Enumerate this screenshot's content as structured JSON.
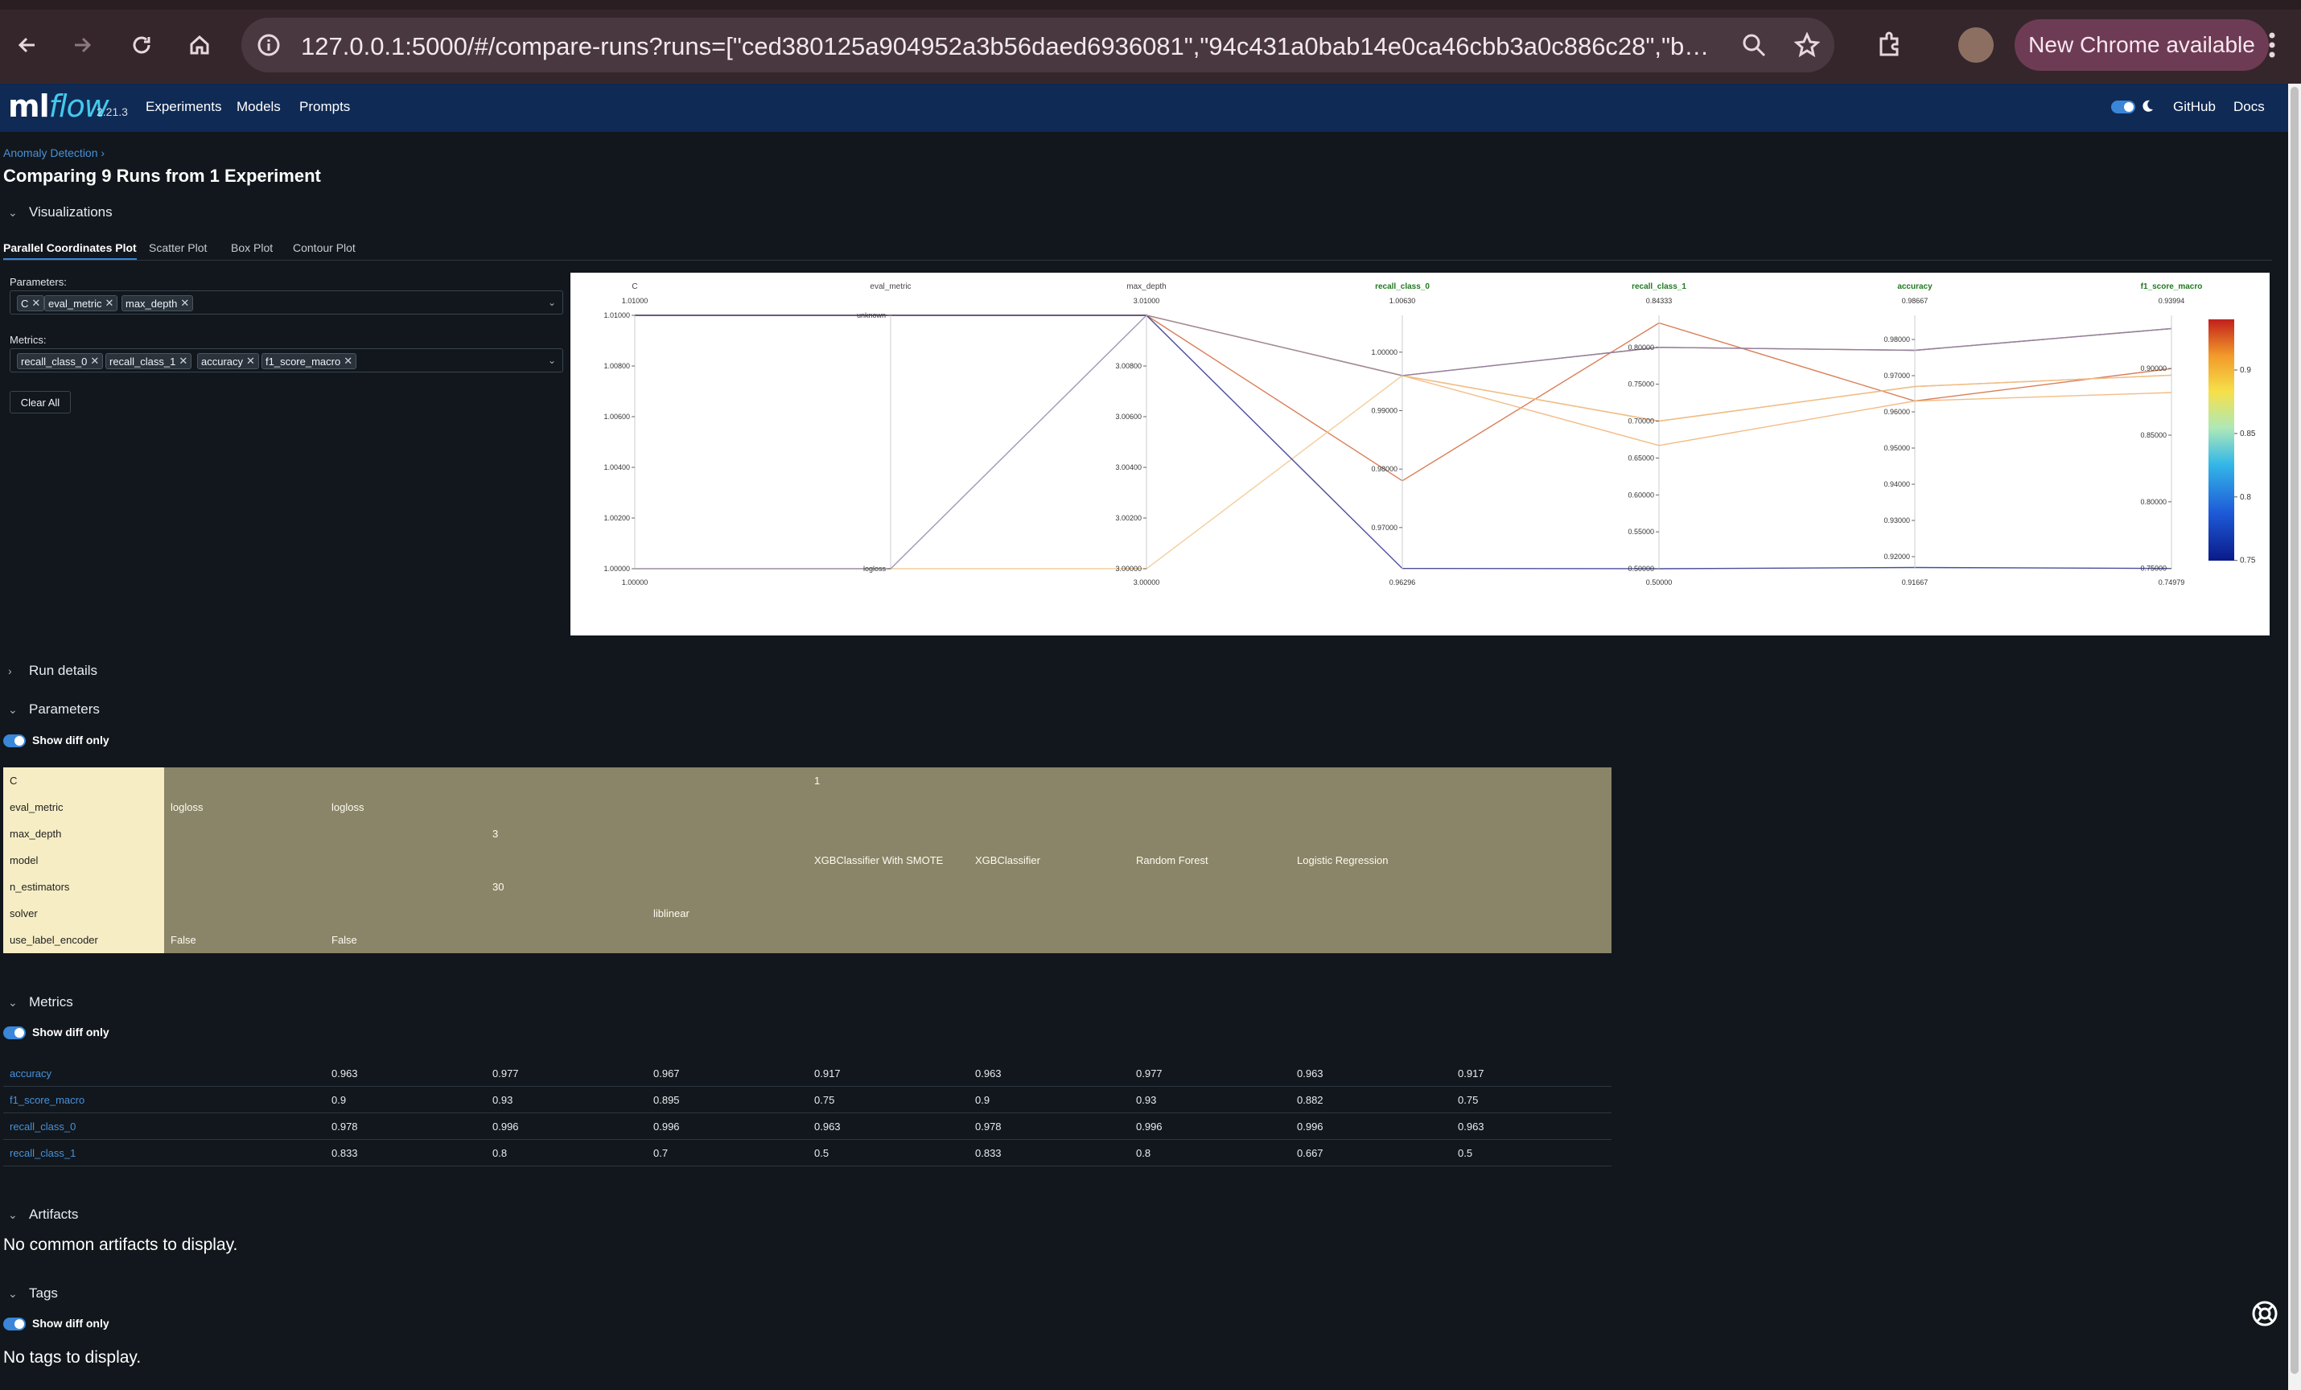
{
  "browser": {
    "url": "127.0.0.1:5000/#/compare-runs?runs=[\"ced380125a904952a3b56daed6936081\",\"94c431a0bab14e0ca46cbb3a0c886c28\",\"bc4f1...",
    "update_label": "New Chrome available"
  },
  "header": {
    "logo_ml": "ml",
    "logo_flow": "flow",
    "version": "2.21.3",
    "nav": [
      "Experiments",
      "Models",
      "Prompts"
    ],
    "github": "GitHub",
    "docs": "Docs"
  },
  "breadcrumb": "Anomaly Detection ›",
  "title": "Comparing 9 Runs from 1 Experiment",
  "sections": {
    "visualizations": "Visualizations",
    "run_details": "Run details",
    "parameters": "Parameters",
    "metrics": "Metrics",
    "artifacts": "Artifacts",
    "tags": "Tags"
  },
  "viz_tabs": [
    "Parallel Coordinates Plot",
    "Scatter Plot",
    "Box Plot",
    "Contour Plot"
  ],
  "controls": {
    "parameters_label": "Parameters:",
    "parameter_chips": [
      "C",
      "eval_metric",
      "max_depth"
    ],
    "metrics_label": "Metrics:",
    "metric_chips": [
      "recall_class_0",
      "recall_class_1",
      "accuracy",
      "f1_score_macro"
    ],
    "clear_all": "Clear All"
  },
  "show_diff_only": "Show diff only",
  "parameters_table": [
    {
      "key": "C",
      "values": [
        "",
        "",
        "",
        "",
        "1",
        "",
        "",
        "",
        ""
      ]
    },
    {
      "key": "eval_metric",
      "values": [
        "logloss",
        "logloss",
        "",
        "",
        "",
        "",
        "",
        "",
        ""
      ]
    },
    {
      "key": "max_depth",
      "values": [
        "",
        "",
        "3",
        "",
        "",
        "",
        "",
        "",
        ""
      ]
    },
    {
      "key": "model",
      "values": [
        "",
        "",
        "",
        "",
        "XGBClassifier With SMOTE",
        "XGBClassifier",
        "Random Forest",
        "Logistic Regression",
        ""
      ]
    },
    {
      "key": "n_estimators",
      "values": [
        "",
        "",
        "30",
        "",
        "",
        "",
        "",
        "",
        ""
      ]
    },
    {
      "key": "solver",
      "values": [
        "",
        "",
        "",
        "liblinear",
        "",
        "",
        "",
        "",
        ""
      ]
    },
    {
      "key": "use_label_encoder",
      "values": [
        "False",
        "False",
        "",
        "",
        "",
        "",
        "",
        "",
        ""
      ]
    }
  ],
  "metrics_table": [
    {
      "key": "accuracy",
      "values": [
        "0.963",
        "0.977",
        "0.967",
        "0.917",
        "0.963",
        "0.977",
        "0.963",
        "0.917"
      ]
    },
    {
      "key": "f1_score_macro",
      "values": [
        "0.9",
        "0.93",
        "0.895",
        "0.75",
        "0.9",
        "0.93",
        "0.882",
        "0.75"
      ]
    },
    {
      "key": "recall_class_0",
      "values": [
        "0.978",
        "0.996",
        "0.996",
        "0.963",
        "0.978",
        "0.996",
        "0.996",
        "0.963"
      ]
    },
    {
      "key": "recall_class_1",
      "values": [
        "0.833",
        "0.8",
        "0.7",
        "0.5",
        "0.833",
        "0.8",
        "0.667",
        "0.5"
      ]
    }
  ],
  "artifacts_msg": "No common artifacts to display.",
  "tags_msg": "No tags to display.",
  "chart_data": {
    "type": "parallel-coordinates",
    "axes": [
      {
        "name": "C",
        "min": 1.0,
        "max": 1.01,
        "top": "1.01000",
        "bottom": "1.00000",
        "ticks": [
          "1.01000",
          "1.00800",
          "1.00600",
          "1.00400",
          "1.00200",
          "1.00000"
        ],
        "categorical": false
      },
      {
        "name": "eval_metric",
        "top": "",
        "bottom": "",
        "ticks": [
          "unknown",
          "logloss"
        ],
        "categorical": true
      },
      {
        "name": "max_depth",
        "min": 3.0,
        "max": 3.01,
        "top": "3.01000",
        "bottom": "3.00000",
        "ticks": [
          "3.00800",
          "3.00600",
          "3.00400",
          "3.00200",
          "3.00000"
        ],
        "categorical": false
      },
      {
        "name": "recall_class_0",
        "min": 0.96296,
        "max": 1.0063,
        "top": "1.00630",
        "bottom": "0.96296",
        "ticks": [
          "1.00000",
          "0.99000",
          "0.98000",
          "0.97000"
        ],
        "tick_values": [
          1.0,
          0.99,
          0.98,
          0.97
        ],
        "categorical": false
      },
      {
        "name": "recall_class_1",
        "min": 0.5,
        "max": 0.84333,
        "top": "0.84333",
        "bottom": "0.50000",
        "ticks": [
          "0.80000",
          "0.75000",
          "0.70000",
          "0.65000",
          "0.60000",
          "0.55000",
          "0.50000"
        ],
        "tick_values": [
          0.8,
          0.75,
          0.7,
          0.65,
          0.6,
          0.55,
          0.5
        ],
        "categorical": false
      },
      {
        "name": "accuracy",
        "min": 0.91667,
        "max": 0.98667,
        "top": "0.98667",
        "bottom": "0.91667",
        "ticks": [
          "0.98000",
          "0.97000",
          "0.96000",
          "0.95000",
          "0.94000",
          "0.93000",
          "0.92000"
        ],
        "tick_values": [
          0.98,
          0.97,
          0.96,
          0.95,
          0.94,
          0.93,
          0.92
        ],
        "categorical": false
      },
      {
        "name": "f1_score_macro",
        "min": 0.74979,
        "max": 0.93994,
        "top": "0.93994",
        "bottom": "0.74979",
        "ticks": [
          "0.90000",
          "0.85000",
          "0.80000",
          "0.75000"
        ],
        "tick_values": [
          0.9,
          0.85,
          0.8,
          0.75
        ],
        "categorical": false
      }
    ],
    "lines": [
      {
        "C": 1.01,
        "eval_metric": "unknown",
        "max_depth": 3.01,
        "recall_class_0": 0.996,
        "recall_class_1": 0.8,
        "accuracy": 0.977,
        "f1_score_macro": 0.93,
        "color": "#b0303a"
      },
      {
        "C": 1.01,
        "eval_metric": "unknown",
        "max_depth": 3.01,
        "recall_class_0": 0.978,
        "recall_class_1": 0.833,
        "accuracy": 0.963,
        "f1_score_macro": 0.9,
        "color": "#d4663a"
      },
      {
        "C": 1.01,
        "eval_metric": "unknown",
        "max_depth": 3.01,
        "recall_class_0": 0.996,
        "recall_class_1": 0.7,
        "accuracy": 0.967,
        "f1_score_macro": 0.895,
        "color": "#e08850"
      },
      {
        "C": 1.01,
        "eval_metric": "unknown",
        "max_depth": 3.01,
        "recall_class_0": 0.996,
        "recall_class_1": 0.667,
        "accuracy": 0.963,
        "f1_score_macro": 0.882,
        "color": "#f0b070"
      },
      {
        "C": 1.0,
        "eval_metric": "logloss",
        "max_depth": 3.0,
        "recall_class_0": 0.996,
        "recall_class_1": 0.7,
        "accuracy": 0.967,
        "f1_score_macro": 0.895,
        "color": "#f2c48a"
      },
      {
        "C": 1.01,
        "eval_metric": "unknown",
        "max_depth": 3.01,
        "recall_class_0": 0.963,
        "recall_class_1": 0.5,
        "accuracy": 0.917,
        "f1_score_macro": 0.75,
        "color": "#2a2f8a"
      },
      {
        "C": 1.0,
        "eval_metric": "logloss",
        "max_depth": 3.01,
        "recall_class_0": 0.996,
        "recall_class_1": 0.8,
        "accuracy": 0.977,
        "f1_score_macro": 0.93,
        "color": "#8a8aa8"
      }
    ],
    "colorscale": {
      "ticks": [
        "0.9",
        "0.85",
        "0.8",
        "0.75"
      ],
      "tick_values": [
        0.9,
        0.85,
        0.8,
        0.75
      ],
      "min": 0.74979,
      "max": 0.93994,
      "colors": [
        "#0a1a8a",
        "#1e5bd8",
        "#34b7e8",
        "#aee8b8",
        "#f6e04a",
        "#f29a2a",
        "#c2201c"
      ]
    }
  }
}
